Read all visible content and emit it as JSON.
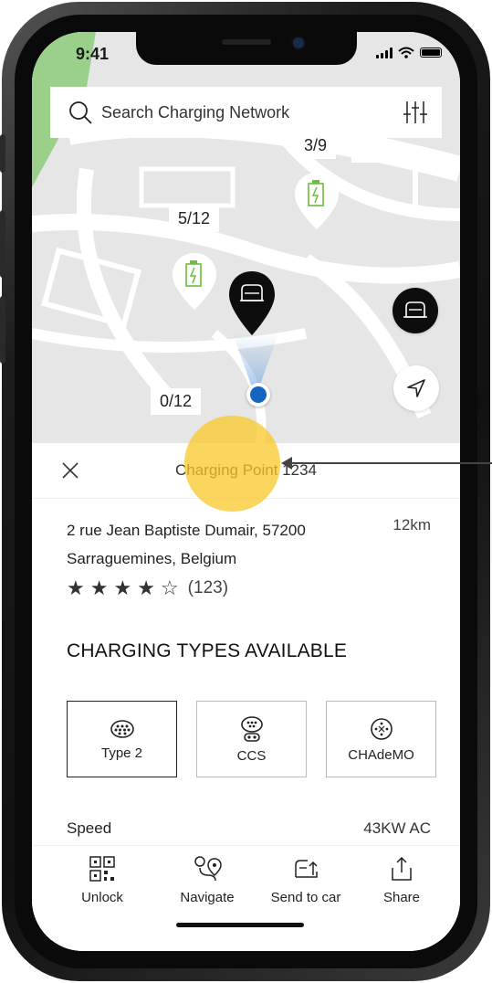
{
  "status": {
    "time": "9:41"
  },
  "search": {
    "placeholder": "Search Charging Network"
  },
  "map": {
    "stations": [
      {
        "count": "3/9"
      },
      {
        "count": "5/12"
      },
      {
        "count": "0/12"
      }
    ]
  },
  "panel": {
    "title": "Charging Point 1234",
    "address_line1": "2 rue Jean Baptiste Dumair, 57200",
    "address_line2": "Sarraguemines, Belgium",
    "distance": "12km",
    "rating": {
      "stars": 4,
      "max": 5,
      "count": "(123)"
    },
    "section_title": "CHARGING TYPES AVAILABLE",
    "types": [
      {
        "label": "Type 2",
        "selected": true
      },
      {
        "label": "CCS",
        "selected": false
      },
      {
        "label": "CHAdeMO",
        "selected": false
      }
    ],
    "speed_label": "Speed",
    "speed_value": "43KW AC"
  },
  "bottom_bar": {
    "unlock": "Unlock",
    "navigate": "Navigate",
    "send_to_car": "Send to car",
    "share": "Share"
  },
  "colors": {
    "accent_blue": "#1565c0",
    "charger_green": "#6bbf3a",
    "highlight": "#f9c82a"
  }
}
